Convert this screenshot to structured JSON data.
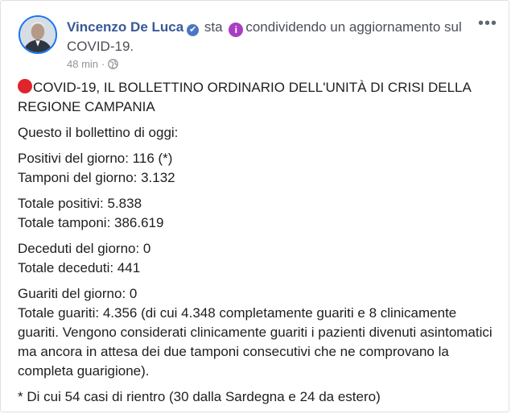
{
  "post": {
    "author": "Vincenzo De Luca",
    "verified_glyph": "✔",
    "action_prefix": "sta",
    "info_glyph": "i",
    "action_text": "condividendo un aggiornamento sul COVID-19.",
    "timestamp": "48 min",
    "separator": "·",
    "more_glyph": "•••",
    "title": "COVID-19, IL BOLLETTINO ORDINARIO DELL'UNITÀ DI CRISI DELLA REGIONE CAMPANIA",
    "intro": "Questo il bollettino di oggi:",
    "positivi_giorno": "Positivi del giorno: 116 (*)",
    "tamponi_giorno": "Tamponi del giorno: 3.132",
    "totale_positivi": "Totale positivi: 5.838",
    "totale_tamponi": "Totale tamponi: 386.619",
    "deceduti_giorno": "Deceduti del giorno: 0",
    "totale_deceduti": "Totale deceduti: 441",
    "guariti_giorno": "Guariti del giorno: 0",
    "totale_guariti": "Totale guariti: 4.356 (di cui 4.348 completamente guariti e 8 clinicamente guariti. Vengono considerati clinicamente guariti i pazienti divenuti asintomatici ma ancora in attesa dei due tamponi consecutivi che ne comprovano la completa guarigione).",
    "footnote": "* Di cui 54 casi di rientro (30 dalla Sardegna e 24 da estero)"
  },
  "icons": {
    "avatar": "profile-photo",
    "verified": "verified-badge-icon",
    "info": "info-icon",
    "globe": "globe-icon",
    "more": "more-options-icon",
    "red_circle": "red-circle-emoji"
  },
  "colors": {
    "author": "#385898",
    "verified": "#4a76c4",
    "info": "#a83fc2",
    "red_circle": "#e0242b",
    "meta": "#90949c",
    "text": "#1c1e21"
  }
}
